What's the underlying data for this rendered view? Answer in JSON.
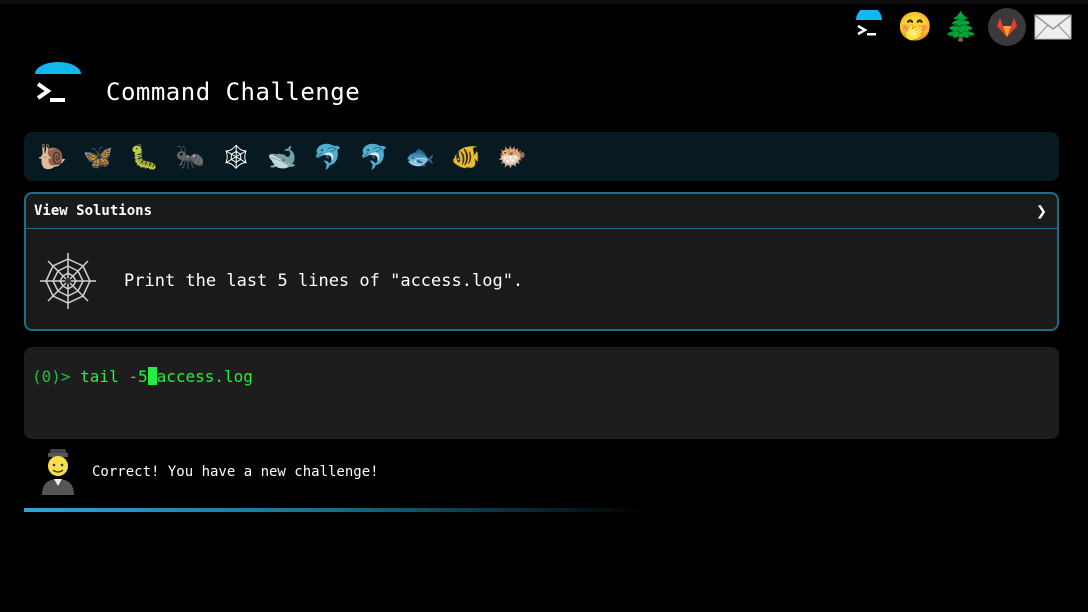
{
  "header": {
    "title": "Command Challenge"
  },
  "top_icons": [
    {
      "name": "terminal-icon"
    },
    {
      "name": "shushing-face-icon",
      "glyph": "🤭"
    },
    {
      "name": "tree-icon",
      "glyph": "🌲"
    },
    {
      "name": "gitlab-icon"
    },
    {
      "name": "mail-icon",
      "glyph": "✉"
    }
  ],
  "animals": [
    "🐌",
    "🦋",
    "🐛",
    "🐜",
    "🕸",
    "🐋",
    "🐬",
    "🐬",
    "🐟",
    "🐠",
    "🐡"
  ],
  "challenge": {
    "header_label": "View Solutions",
    "chevron": "❯",
    "icon": "spider-web-icon",
    "text": "Print the last 5 lines of \"access.log\"."
  },
  "terminal": {
    "prompt": "(0)>",
    "command_before_cursor": " tail -5",
    "command_after_cursor": "access.log"
  },
  "status": {
    "message": "Correct! You have a new challenge!"
  },
  "colors": {
    "accent": "#1e6f86",
    "terminal_text": "#22ee44",
    "progress": "#2ea6d6"
  }
}
